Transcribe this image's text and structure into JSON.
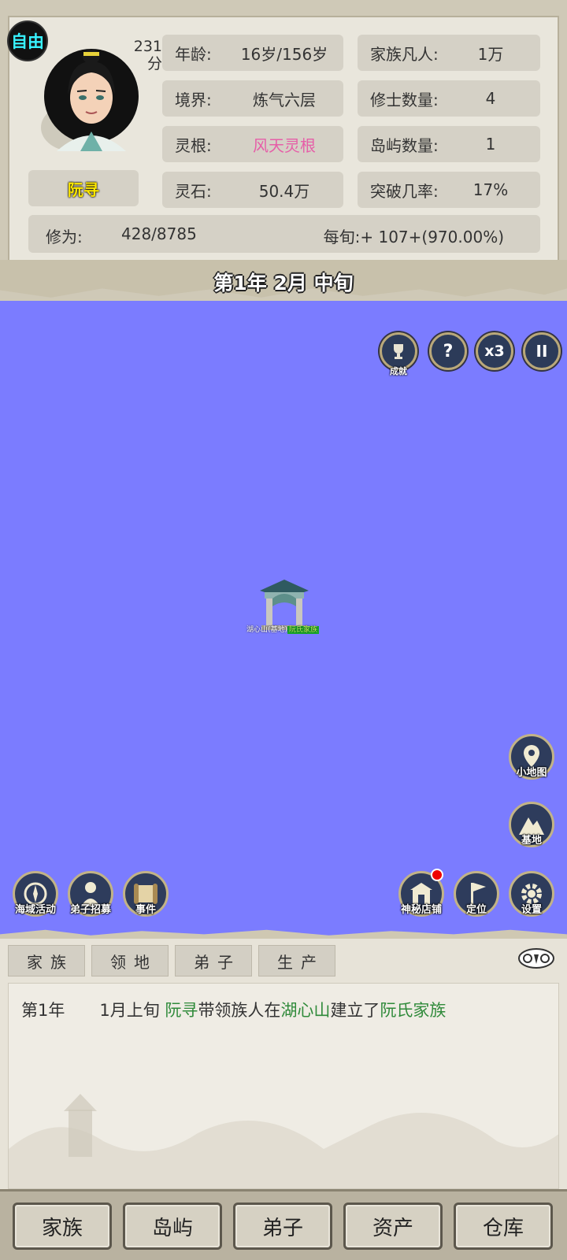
{
  "header": {
    "free_badge": "自由",
    "score": "231",
    "score_unit": "分",
    "name": "阮寻",
    "date": "第1年 2月 中旬"
  },
  "stats_left": [
    {
      "label": "年龄:",
      "value": "16岁/156岁"
    },
    {
      "label": "境界:",
      "value": "炼气六层"
    },
    {
      "label": "灵根:",
      "value": "风天灵根"
    },
    {
      "label": "灵石:",
      "value": "50.4万"
    }
  ],
  "stats_right": [
    {
      "label": "家族凡人:",
      "value": "1万"
    },
    {
      "label": "修士数量:",
      "value": "4"
    },
    {
      "label": "岛屿数量:",
      "value": "1"
    },
    {
      "label": "突破几率:",
      "value": "17%"
    }
  ],
  "cultivation": {
    "label": "修为:",
    "value": "428/8785",
    "rate": "每旬:+ 107+(970.00%)"
  },
  "top_controls": {
    "achievement": "成就",
    "help": "?",
    "speed": "x3",
    "pause": "II"
  },
  "map": {
    "location_name": "湖心山(基地)",
    "clan_name": "阮氏家族"
  },
  "side_buttons": {
    "minimap": "小地图",
    "base": "基地"
  },
  "bottom_left_buttons": [
    "海域活动",
    "弟子招募",
    "事件"
  ],
  "bottom_right_buttons": [
    "神秘店铺",
    "定位",
    "设置"
  ],
  "sub_tabs": [
    "家族",
    "领地",
    "弟子",
    "生产"
  ],
  "log": {
    "year": "第1年",
    "period": "1月上旬",
    "person": "阮寻",
    "text1": "带领族人在",
    "place": "湖心山",
    "text2": "建立了",
    "clan": "阮氏家族"
  },
  "bottom_nav": [
    "家族",
    "岛屿",
    "弟子",
    "资产",
    "仓库"
  ],
  "colors": {
    "map_water": "#7b7cff",
    "spirit_root": "#e65ea8",
    "log_highlight": "#2f8a3a",
    "name_plate_text": "#ffe900",
    "free_badge_text": "#38f2ff"
  }
}
